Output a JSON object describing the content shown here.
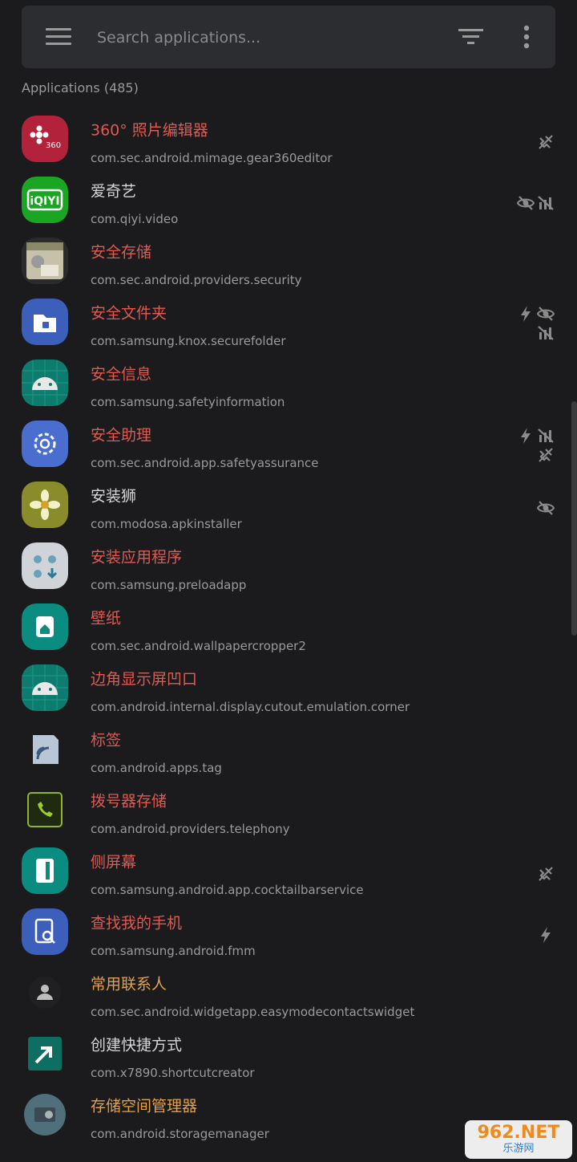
{
  "search": {
    "placeholder": "Search applications..."
  },
  "section_title": "Applications (485)",
  "colors": {
    "red_name": "#e05a52",
    "white_name": "#d6d6d6",
    "orange_name": "#e2a24a",
    "badge": "#8b8b8b"
  },
  "apps": [
    {
      "name": "360° 照片编辑器",
      "pkg": "com.sec.android.mimage.gear360editor",
      "color": "red",
      "icon": "gear360-icon",
      "badges": [
        "no-internet"
      ]
    },
    {
      "name": "爱奇艺",
      "pkg": "com.qiyi.video",
      "color": "white",
      "icon": "iqiyi-icon",
      "badges": [
        "hidden",
        "no-signal"
      ]
    },
    {
      "name": "安全存储",
      "pkg": "com.sec.android.providers.security",
      "color": "red",
      "icon": "security-storage-icon",
      "badges": []
    },
    {
      "name": "安全文件夹",
      "pkg": "com.samsung.knox.securefolder",
      "color": "red",
      "icon": "secure-folder-icon",
      "badges": [
        "bolt",
        "hidden",
        "no-signal"
      ]
    },
    {
      "name": "安全信息",
      "pkg": "com.samsung.safetyinformation",
      "color": "red",
      "icon": "android-icon",
      "badges": []
    },
    {
      "name": "安全助理",
      "pkg": "com.sec.android.app.safetyassurance",
      "color": "red",
      "icon": "settings-gear-icon",
      "badges": [
        "bolt",
        "no-signal",
        "no-internet"
      ]
    },
    {
      "name": "安装狮",
      "pkg": "com.modosa.apkinstaller",
      "color": "white",
      "icon": "flower-icon",
      "badges": [
        "hidden"
      ]
    },
    {
      "name": "安装应用程序",
      "pkg": "com.samsung.preloadapp",
      "color": "red",
      "icon": "install-apps-icon",
      "badges": []
    },
    {
      "name": "壁纸",
      "pkg": "com.sec.android.wallpapercropper2",
      "color": "red",
      "icon": "wallpaper-icon",
      "badges": []
    },
    {
      "name": "边角显示屏凹口",
      "pkg": "com.android.internal.display.cutout.emulation.corner",
      "color": "red",
      "icon": "android-icon",
      "badges": []
    },
    {
      "name": "标签",
      "pkg": "com.android.apps.tag",
      "color": "red",
      "icon": "nfc-tag-icon",
      "badges": []
    },
    {
      "name": "拨号器存储",
      "pkg": "com.android.providers.telephony",
      "color": "red",
      "icon": "phone-icon",
      "badges": []
    },
    {
      "name": "侧屏幕",
      "pkg": "com.samsung.android.app.cocktailbarservice",
      "color": "red",
      "icon": "edge-panel-icon",
      "badges": [
        "no-internet"
      ]
    },
    {
      "name": "查找我的手机",
      "pkg": "com.samsung.android.fmm",
      "color": "red",
      "icon": "find-phone-icon",
      "badges": [
        "bolt"
      ]
    },
    {
      "name": "常用联系人",
      "pkg": "com.sec.android.widgetapp.easymodecontactswidget",
      "color": "orange",
      "icon": "contact-icon",
      "badges": []
    },
    {
      "name": "创建快捷方式",
      "pkg": "com.x7890.shortcutcreator",
      "color": "white",
      "icon": "shortcut-icon",
      "badges": []
    },
    {
      "name": "存储空间管理器",
      "pkg": "com.android.storagemanager",
      "color": "orange",
      "icon": "storage-manager-icon",
      "badges": []
    }
  ],
  "watermark": {
    "brand": "962.NET",
    "sub": "乐游网"
  }
}
